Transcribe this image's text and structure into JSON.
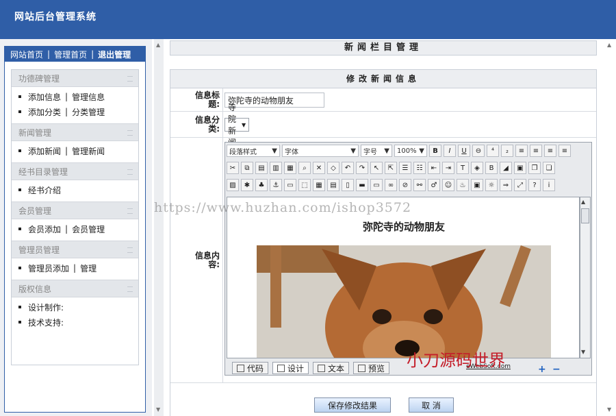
{
  "header": {
    "title": "网站后台管理系统"
  },
  "topnav": {
    "items": [
      "网站首页",
      "管理首页",
      "退出管理"
    ],
    "separator": "|"
  },
  "sidebar": {
    "sections": [
      {
        "title": "功德碑管理",
        "lines": [
          [
            "添加信息",
            "管理信息"
          ],
          [
            "添加分类",
            "分类管理"
          ]
        ]
      },
      {
        "title": "新闻管理",
        "lines": [
          [
            "添加新闻",
            "管理新闻"
          ]
        ]
      },
      {
        "title": "经书目录管理",
        "lines": [
          [
            "经书介绍"
          ]
        ]
      },
      {
        "title": "会员管理",
        "lines": [
          [
            "会员添加",
            "会员管理"
          ]
        ]
      },
      {
        "title": "管理员管理",
        "lines": [
          [
            "管理员添加",
            "管理"
          ]
        ]
      },
      {
        "title": "版权信息",
        "lines": [
          [
            "设计制作:"
          ],
          [
            "技术支持:"
          ]
        ]
      }
    ]
  },
  "main": {
    "page_title": "新闻栏目管理",
    "form_title": "修改新闻信息",
    "fields": {
      "title": {
        "label": "信息标题:",
        "value": "弥陀寺的动物朋友"
      },
      "category": {
        "label": "信息分类:",
        "value": "寺院新闻"
      },
      "content": {
        "label": "信息内容:"
      }
    },
    "editor": {
      "dropdowns": {
        "style": "段落样式",
        "font": "字体",
        "size": "字号",
        "zoom": "100%"
      },
      "doc_heading": "弥陀寺的动物朋友",
      "tabs": [
        "代码",
        "设计",
        "文本",
        "预览"
      ],
      "active_tab": "设计",
      "brand": "eWebSoft.com"
    },
    "buttons": {
      "save": "保存修改结果",
      "cancel": "取 消"
    }
  },
  "overlays": {
    "watermark": "https://www.huzhan.com/ishop3572",
    "editor_stamp": "小刀源码世界"
  },
  "colors": {
    "accent": "#2f5ea7",
    "stamp": "#c41e2a"
  }
}
